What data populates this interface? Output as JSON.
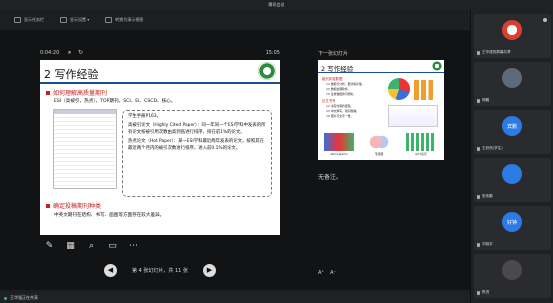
{
  "window": {
    "title": "腾讯会议"
  },
  "toolbar": {
    "items": [
      {
        "label": "显示任务栏",
        "icon": "taskbar-icon"
      },
      {
        "label": "显示设置 ▾",
        "icon": "display-settings-icon"
      },
      {
        "label": "转换为演示视图",
        "icon": "swap-view-icon"
      }
    ]
  },
  "presenter": {
    "elapsed": "0:04:20",
    "clock": "15:05",
    "next_label": "下一张幻灯片",
    "notes_placeholder": "无备注。",
    "font_larger": "A⁺",
    "font_smaller": "A⁻"
  },
  "slide": {
    "title": "2 写作经验",
    "bullet1": "如何理解高质量期刊",
    "line1": "ESI（高被引，热点），TOP期刊，SCI、EI、CSCD、核心。",
    "note_p1": "学生手册P163。",
    "note_p2": "高被引论文（Highly Cited Paper）：同一年同一个ESI学科中发表的所有论文按被引用次数由高到低进行排序，排在前1%的论文。",
    "note_p3": "热点论文（Hot Paper）：某一ESI学科最近两年发表的论文，按照其在最近两个月内的被引次数进行排序，进入前0.1%的论文。",
    "bullet2": "确定投稿期刊种类",
    "line2": "中英文期刊在结构、书写、画图等方面存在较大差异。"
  },
  "next_slide": {
    "title": "2 写作经验",
    "b1": "组织实验数据",
    "l1": "(1) 数据与分析，要清晰易懂。",
    "l2": "(2) 数据处理软件。",
    "l3": "(3) 注重数据的可视化。",
    "b2": "论文书写",
    "l4": "(1) 书写时保持逻辑。",
    "l5": "(2) 中文撰写，用词准确。",
    "l6": "(3) 图片与文字一致。",
    "cap1": "Nomograms",
    "cap2": "韦恩图",
    "cap3": "GCT表示"
  },
  "pager": {
    "info": "第 4 张幻灯片，共 11 张"
  },
  "participants": [
    {
      "name": "王华强的屏幕共享",
      "color": "#d9402f"
    },
    {
      "name": "邢鹏",
      "color": "#5b6b7a"
    },
    {
      "name": "王欣然(学生)",
      "color": "#2c7be5"
    },
    {
      "name": "张伟鹏",
      "color": "#2c7be5"
    },
    {
      "name": "刘晓宇",
      "color": "#2c7be5"
    },
    {
      "name": "陈进",
      "color": "#4a4a4a"
    },
    {
      "name": "杨丽",
      "color": "#8a7060"
    }
  ],
  "participant_badges": [
    "",
    "",
    "宾鹏",
    "",
    "好钟",
    "",
    ""
  ],
  "status": {
    "text": "王华强正在共享"
  }
}
